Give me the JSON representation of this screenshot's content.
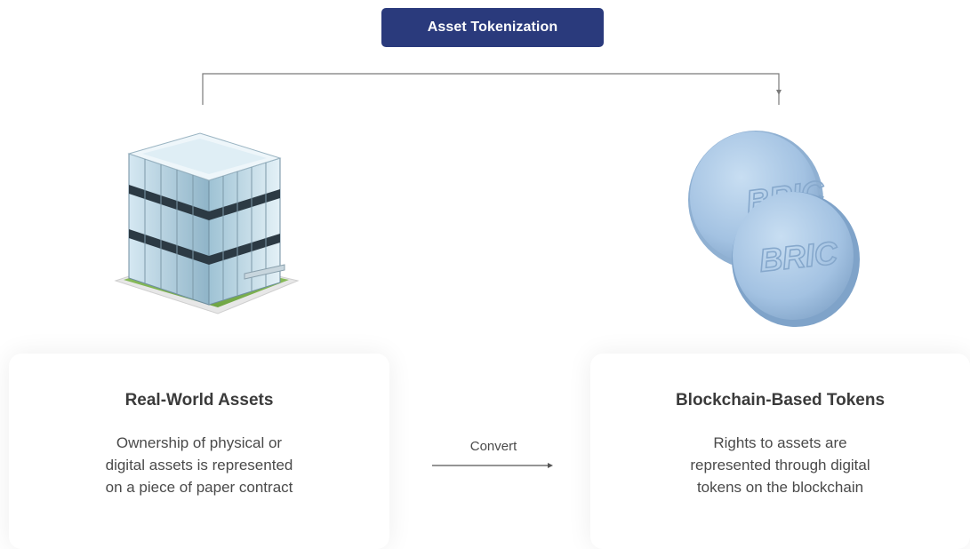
{
  "title": "Asset Tokenization",
  "left_card": {
    "title": "Real-World Assets",
    "lines": [
      "Ownership of physical or",
      "digital assets is represented",
      "on a piece of paper contract"
    ]
  },
  "right_card": {
    "title": "Blockchain-Based Tokens",
    "lines": [
      "Rights to assets are",
      "represented through digital",
      "tokens on the blockchain"
    ]
  },
  "convert_label": "Convert",
  "token_text": "BRIC",
  "colors": {
    "badge": "#2a3a7c",
    "connector": "#7a7a7a",
    "token": "#a9c8e8"
  },
  "icons": {
    "left": "office-building-icon",
    "right": "bric-token-coins-icon"
  }
}
